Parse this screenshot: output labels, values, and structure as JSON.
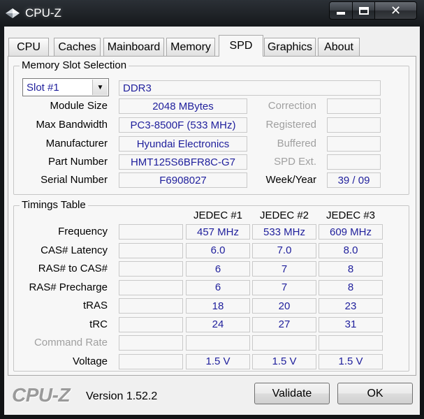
{
  "window": {
    "title": "CPU-Z"
  },
  "tabs": [
    "CPU",
    "Caches",
    "Mainboard",
    "Memory",
    "SPD",
    "Graphics",
    "About"
  ],
  "active_tab": "SPD",
  "slot_group": {
    "title": "Memory Slot Selection",
    "slot_selected": "Slot #1",
    "memory_type": "DDR3",
    "labels": {
      "module_size": "Module Size",
      "max_bandwidth": "Max Bandwidth",
      "manufacturer": "Manufacturer",
      "part_number": "Part Number",
      "serial_number": "Serial Number",
      "correction": "Correction",
      "registered": "Registered",
      "buffered": "Buffered",
      "spd_ext": "SPD Ext.",
      "week_year": "Week/Year"
    },
    "values": {
      "module_size": "2048 MBytes",
      "max_bandwidth": "PC3-8500F (533 MHz)",
      "manufacturer": "Hyundai Electronics",
      "part_number": "HMT125S6BFR8C-G7",
      "serial_number": "F6908027",
      "correction": "",
      "registered": "",
      "buffered": "",
      "spd_ext": "",
      "week_year": "39 / 09"
    }
  },
  "timings": {
    "title": "Timings Table",
    "columns": [
      "JEDEC #1",
      "JEDEC #2",
      "JEDEC #3"
    ],
    "rows": [
      {
        "label": "Frequency",
        "values": [
          "457 MHz",
          "533 MHz",
          "609 MHz"
        ],
        "disabled": false
      },
      {
        "label": "CAS# Latency",
        "values": [
          "6.0",
          "7.0",
          "8.0"
        ],
        "disabled": false
      },
      {
        "label": "RAS# to CAS#",
        "values": [
          "6",
          "7",
          "8"
        ],
        "disabled": false
      },
      {
        "label": "RAS# Precharge",
        "values": [
          "6",
          "7",
          "8"
        ],
        "disabled": false
      },
      {
        "label": "tRAS",
        "values": [
          "18",
          "20",
          "23"
        ],
        "disabled": false
      },
      {
        "label": "tRC",
        "values": [
          "24",
          "27",
          "31"
        ],
        "disabled": false
      },
      {
        "label": "Command Rate",
        "values": [
          "",
          "",
          ""
        ],
        "disabled": true
      },
      {
        "label": "Voltage",
        "values": [
          "1.5 V",
          "1.5 V",
          "1.5 V"
        ],
        "disabled": false
      }
    ]
  },
  "footer": {
    "logo": "CPU-Z",
    "version": "Version 1.52.2",
    "validate_label": "Validate",
    "ok_label": "OK"
  },
  "colors": {
    "value_text": "#1f1f9c",
    "disabled_text": "#a0a0a0",
    "panel_bg": "#f7f7f7"
  },
  "icons": [
    "cpu-z-app-icon",
    "minimize-icon",
    "maximize-icon",
    "close-icon",
    "chevron-down-icon"
  ]
}
